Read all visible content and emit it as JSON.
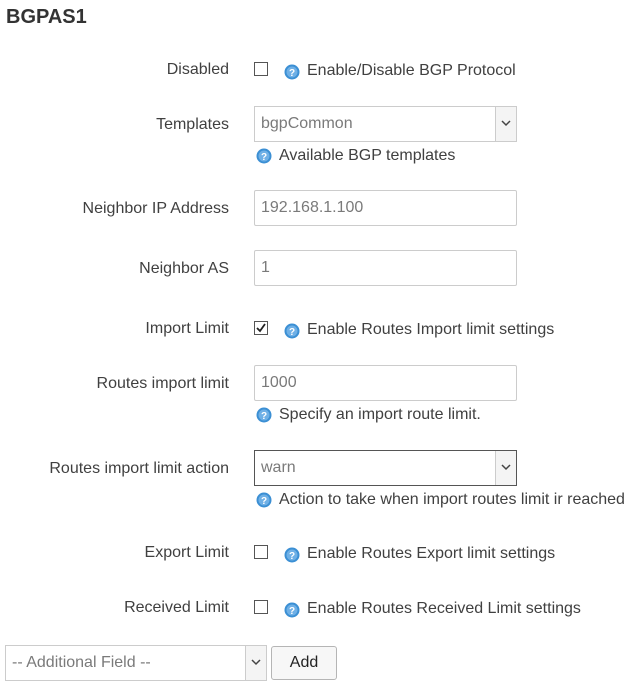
{
  "title": "BGPAS1",
  "fields": {
    "disabled": {
      "label": "Disabled",
      "checked": false,
      "help": "Enable/Disable BGP Protocol"
    },
    "templates": {
      "label": "Templates",
      "value": "bgpCommon",
      "help": "Available BGP templates"
    },
    "neighbor_ip": {
      "label": "Neighbor IP Address",
      "value": "192.168.1.100"
    },
    "neighbor_as": {
      "label": "Neighbor AS",
      "value": "1"
    },
    "import_limit": {
      "label": "Import Limit",
      "checked": true,
      "help": "Enable Routes Import limit settings"
    },
    "routes_import_limit": {
      "label": "Routes import limit",
      "value": "1000",
      "help": "Specify an import route limit."
    },
    "routes_import_limit_action": {
      "label": "Routes import limit action",
      "value": "warn",
      "help": "Action to take when import routes limit ir reached"
    },
    "export_limit": {
      "label": "Export Limit",
      "checked": false,
      "help": "Enable Routes Export limit settings"
    },
    "received_limit": {
      "label": "Received Limit",
      "checked": false,
      "help": "Enable Routes Received Limit settings"
    }
  },
  "additional": {
    "placeholder": "-- Additional Field --",
    "add_label": "Add"
  },
  "icons": {
    "help": "help-icon",
    "check": "checkmark-icon",
    "dropdown": "chevron-down-icon"
  },
  "colors": {
    "help_icon": "#3b8fd4",
    "border": "#cccccc"
  }
}
